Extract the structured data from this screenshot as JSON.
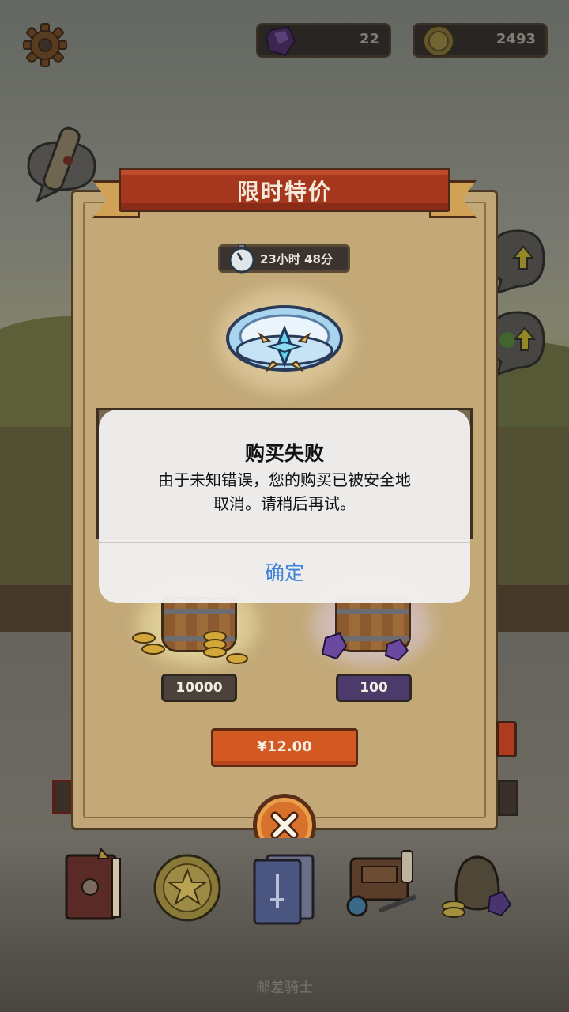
{
  "top_bar": {
    "settings_icon": "gear-icon",
    "gems": {
      "icon": "purple-gem-icon",
      "value": "22"
    },
    "coins": {
      "icon": "gold-coin-icon",
      "value": "2493"
    }
  },
  "offer_panel": {
    "title": "限时特价",
    "timer": {
      "icon": "stopwatch-icon",
      "text": "23小时 48分"
    },
    "item_icon": "winged-ring-icon",
    "rewards": [
      {
        "icon": "coin-barrel-icon",
        "amount": "10000"
      },
      {
        "icon": "gem-barrel-icon",
        "amount": "100"
      }
    ],
    "buy_label": "¥12.00",
    "close_icon": "close-x-icon"
  },
  "alert": {
    "title": "购买失败",
    "message_line1": "由于未知错误，您的购买已被安全地",
    "message_line2": "取消。请稍后再试。",
    "confirm_label": "确定"
  },
  "side_icons": [
    "quest-scroll-icon",
    "upgrade-pot-icon",
    "upgrade-potion-icon"
  ],
  "bottom_nav": {
    "items": [
      "spellbook-icon",
      "star-coin-icon",
      "cards-icon",
      "backpack-icon",
      "treasure-bag-icon"
    ],
    "label": "邮差骑士"
  },
  "colors": {
    "ribbon": "#a6371f",
    "panel": "#c1a677",
    "buy_button": "#d25a22",
    "dialog_button_text": "#3b82d8"
  }
}
